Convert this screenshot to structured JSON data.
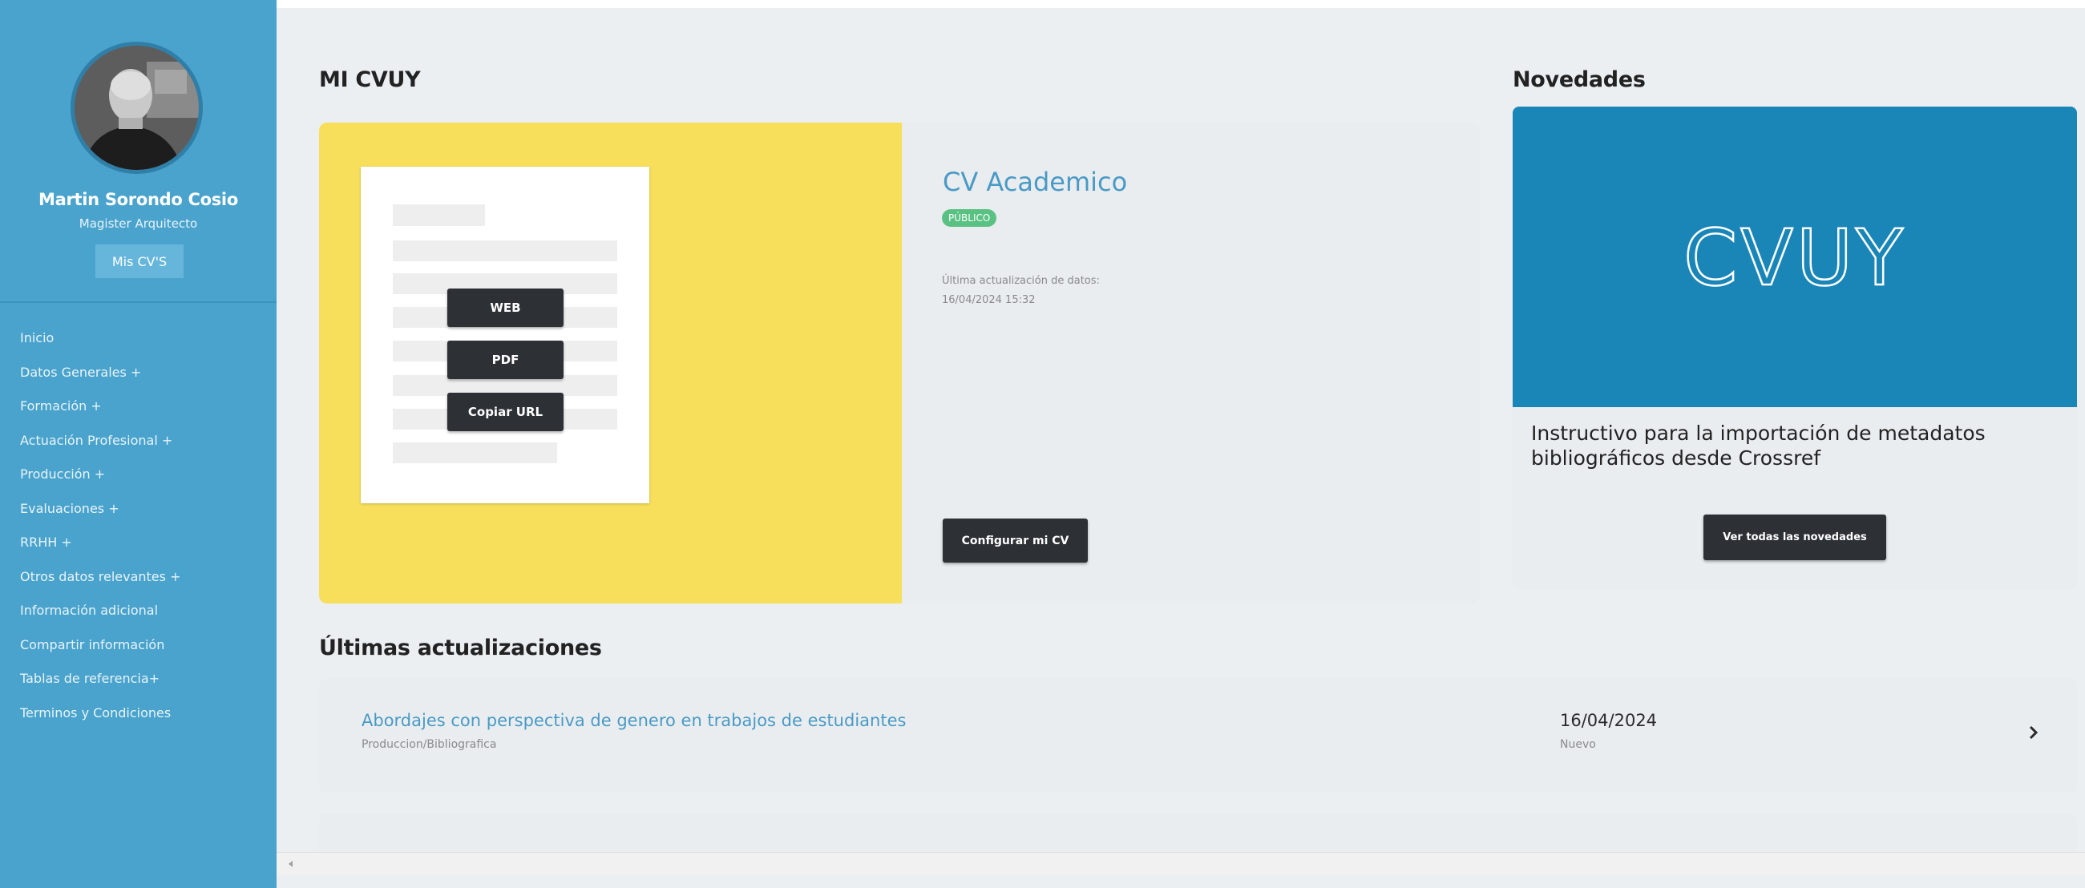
{
  "user": {
    "name": "Martin Sorondo Cosio",
    "role": "Magister Arquitecto",
    "mis_cvs_label": "Mis CV'S"
  },
  "nav": {
    "items": [
      "Inicio",
      "Datos Generales +",
      "Formación +",
      "Actuación Profesional +",
      "Producción +",
      "Evaluaciones +",
      "RRHH +",
      "Otros datos relevantes +",
      "Información adicional",
      "Compartir información",
      "Tablas de referencia+",
      "Terminos y Condiciones"
    ]
  },
  "mi_cvuy": {
    "heading": "MI CVUY",
    "buttons": {
      "web": "WEB",
      "pdf": "PDF",
      "copy_url": "Copiar URL"
    },
    "cv_title": "CV Academico",
    "badge": "PÚBLICO",
    "update_label": "Última actualización de datos:",
    "update_date": "16/04/2024 15:32",
    "configure_label": "Configurar mi CV"
  },
  "novedades": {
    "heading": "Novedades",
    "banner_logo": "CVUY",
    "text": "Instructivo para la importación de metadatos bibliográficos desde Crossref",
    "all_news_label": "Ver todas las novedades"
  },
  "updates": {
    "heading": "Últimas actualizaciones",
    "items": [
      {
        "title": "Abordajes con perspectiva de genero en trabajos de estudiantes",
        "category": "Produccion/Bibliografica",
        "date": "16/04/2024",
        "status": "Nuevo"
      }
    ]
  },
  "colors": {
    "sidebar": "#4aa3cc",
    "accent_yellow": "#f7df5b",
    "banner_blue": "#1a86b8",
    "badge_green": "#59c283",
    "dark_button": "#2d3136",
    "link_blue": "#4a9ac5"
  }
}
